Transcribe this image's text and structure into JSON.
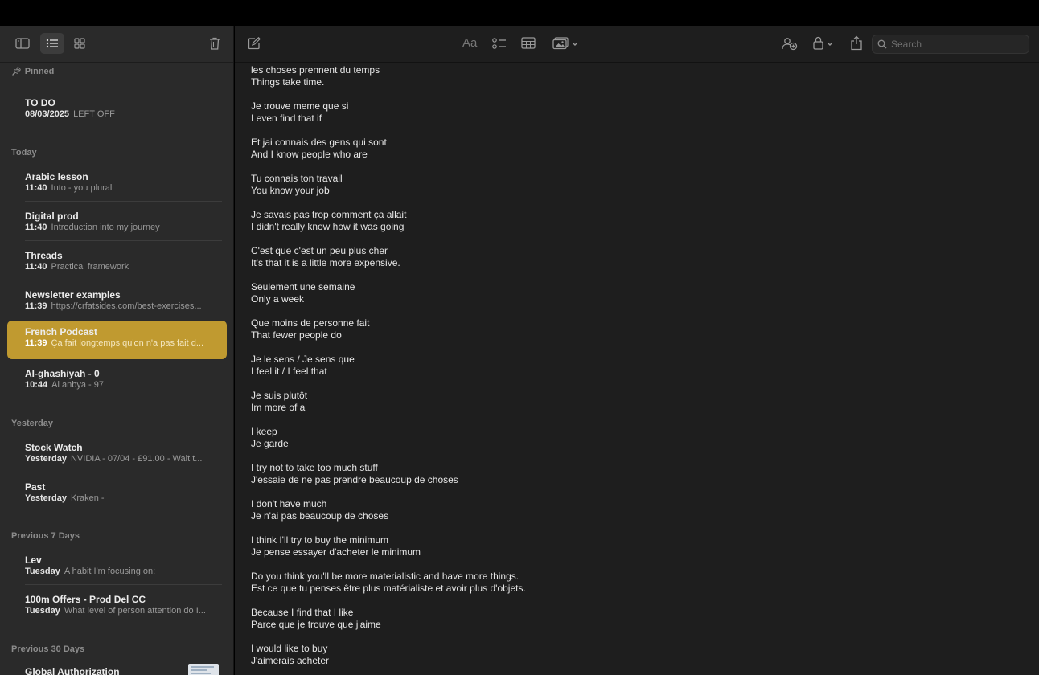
{
  "search": {
    "placeholder": "Search"
  },
  "toolbar": {
    "format_label": "Aa"
  },
  "sidebar": {
    "sections": {
      "pinned": "Pinned",
      "today": "Today",
      "yesterday": "Yesterday",
      "prev7": "Previous 7 Days",
      "prev30": "Previous 30 Days"
    },
    "notes": [
      {
        "title": "TO DO",
        "date": "08/03/2025",
        "preview": "LEFT OFF"
      },
      {
        "title": "Arabic lesson",
        "date": "11:40",
        "preview": "Into - you plural"
      },
      {
        "title": "Digital prod",
        "date": "11:40",
        "preview": "Introduction into my journey"
      },
      {
        "title": "Threads",
        "date": "11:40",
        "preview": "Practical framework"
      },
      {
        "title": "Newsletter examples",
        "date": "11:39",
        "preview": "https://crfatsides.com/best-exercises..."
      },
      {
        "title": "French Podcast",
        "date": "11:39",
        "preview": "Ça fait longtemps qu'on n'a pas fait d..."
      },
      {
        "title": "Al-ghashiyah - 0",
        "date": "10:44",
        "preview": "Al anbya - 97"
      },
      {
        "title": "Stock Watch",
        "date": "Yesterday",
        "preview": "NVIDIA - 07/04 - £91.00 - Wait t..."
      },
      {
        "title": "Past",
        "date": "Yesterday",
        "preview": "Kraken -"
      },
      {
        "title": "Lev",
        "date": "Tuesday",
        "preview": "A habit I'm focusing on:"
      },
      {
        "title": "100m Offers - Prod Del CC",
        "date": "Tuesday",
        "preview": "What level of person attention do I..."
      },
      {
        "title": "Global Authorization",
        "date": "",
        "preview": ""
      }
    ]
  },
  "note_content": {
    "lines": [
      [
        "les choses prennent du temps",
        "Things take time."
      ],
      [
        "Je trouve meme que si",
        "I even find that if"
      ],
      [
        "Et jai connais des gens qui sont",
        "And I know people who are"
      ],
      [
        "Tu connais ton travail",
        "You know your job"
      ],
      [
        "Je savais pas trop comment ça allait",
        "I didn't really know how it was going"
      ],
      [
        "C'est que c'est un peu plus cher",
        "It's that it is a little more expensive."
      ],
      [
        "Seulement une semaine",
        "Only a week"
      ],
      [
        "Que moins de personne fait",
        "That fewer people do"
      ],
      [
        "Je le sens / Je sens que",
        "I feel it / I feel that"
      ],
      [
        "Je suis plutôt",
        "Im more of a"
      ],
      [
        "I keep",
        "Je garde"
      ],
      [
        "I try not to take too much stuff",
        "J'essaie de ne pas prendre beaucoup de choses"
      ],
      [
        "I don't have much",
        "Je n'ai pas beaucoup de choses"
      ],
      [
        "I think I'll try to buy the minimum",
        "Je pense essayer d'acheter le minimum"
      ],
      [
        "Do you think you'll be more materialistic and have more things.",
        "Est ce que tu penses être plus matérialiste et avoir plus d'objets."
      ],
      [
        "Because I find that I like",
        "Parce que je trouve que j'aime"
      ],
      [
        "I would like to buy",
        "J'aimerais acheter"
      ]
    ]
  },
  "colors": {
    "selected_note": "#c09a30",
    "sidebar_bg": "#2a2a2a",
    "editor_bg": "#1e1e1e"
  },
  "icons": [
    "sidebar-toggle-icon",
    "list-view-icon",
    "gallery-view-icon",
    "trash-icon",
    "compose-icon",
    "checklist-icon",
    "table-icon",
    "media-icon",
    "collaborate-icon",
    "lock-icon",
    "share-icon",
    "search-icon",
    "pin-icon"
  ]
}
